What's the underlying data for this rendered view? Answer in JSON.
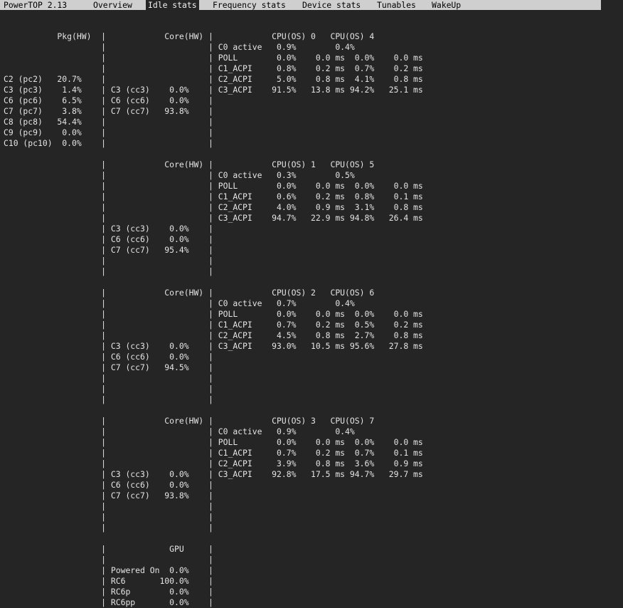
{
  "menu": {
    "app_title": "PowerTOP 2.13",
    "tabs": [
      {
        "label": "Overview",
        "active": false
      },
      {
        "label": "Idle stats",
        "active": true
      },
      {
        "label": "Frequency stats",
        "active": false
      },
      {
        "label": "Device stats",
        "active": false
      },
      {
        "label": "Tunables",
        "active": false
      },
      {
        "label": "WakeUp",
        "active": false
      }
    ]
  },
  "colors": {
    "background": "#252525",
    "menubar": "#cfcfcf",
    "text": "#e4e4e4"
  },
  "screen_lines": [
    "           Pkg(HW)  |            Core(HW) |            CPU(OS) 0   CPU(OS) 4",
    "                    |                     | C0 active   0.9%        0.4%",
    "                    |                     | POLL        0.0%    0.0 ms  0.0%    0.0 ms",
    "                    |                     | C1_ACPI     0.8%    0.2 ms  0.7%    0.2 ms",
    "C2 (pc2)   20.7%    |                     | C2_ACPI     5.0%    0.8 ms  4.1%    0.8 ms",
    "C3 (pc3)    1.4%    | C3 (cc3)    0.0%    | C3_ACPI    91.5%   13.8 ms 94.2%   25.1 ms",
    "C6 (pc6)    6.5%    | C6 (cc6)    0.0%    |",
    "C7 (pc7)    3.8%    | C7 (cc7)   93.8%    |",
    "C8 (pc8)   54.4%    |                     |",
    "C9 (pc9)    0.0%    |                     |",
    "C10 (pc10)  0.0%    |                     |",
    "",
    "                    |            Core(HW) |            CPU(OS) 1   CPU(OS) 5",
    "                    |                     | C0 active   0.3%        0.5%",
    "                    |                     | POLL        0.0%    0.0 ms  0.0%    0.0 ms",
    "                    |                     | C1_ACPI     0.6%    0.2 ms  0.8%    0.1 ms",
    "                    |                     | C2_ACPI     4.0%    0.9 ms  3.1%    0.8 ms",
    "                    |                     | C3_ACPI    94.7%   22.9 ms 94.8%   26.4 ms",
    "                    | C3 (cc3)    0.0%    |",
    "                    | C6 (cc6)    0.0%    |",
    "                    | C7 (cc7)   95.4%    |",
    "                    |                     |",
    "                    |                     |",
    "",
    "                    |            Core(HW) |            CPU(OS) 2   CPU(OS) 6",
    "                    |                     | C0 active   0.7%        0.4%",
    "                    |                     | POLL        0.0%    0.0 ms  0.0%    0.0 ms",
    "                    |                     | C1_ACPI     0.7%    0.2 ms  0.5%    0.2 ms",
    "                    |                     | C2_ACPI     4.5%    0.8 ms  2.7%    0.8 ms",
    "                    | C3 (cc3)    0.0%    | C3_ACPI    93.0%   10.5 ms 95.6%   27.8 ms",
    "                    | C6 (cc6)    0.0%    |",
    "                    | C7 (cc7)   94.5%    |",
    "                    |                     |",
    "                    |                     |",
    "                    |                     |",
    "",
    "                    |            Core(HW) |            CPU(OS) 3   CPU(OS) 7",
    "                    |                     | C0 active   0.9%        0.4%",
    "                    |                     | POLL        0.0%    0.0 ms  0.0%    0.0 ms",
    "                    |                     | C1_ACPI     0.7%    0.2 ms  0.7%    0.1 ms",
    "                    |                     | C2_ACPI     3.9%    0.8 ms  3.6%    0.9 ms",
    "                    | C3 (cc3)    0.0%    | C3_ACPI    92.8%   17.5 ms 94.7%   29.7 ms",
    "                    | C6 (cc6)    0.0%    |",
    "                    | C7 (cc7)   93.8%    |",
    "                    |                     |",
    "                    |                     |",
    "                    |                     |",
    "",
    "                    |             GPU     |",
    "                    |                     |",
    "                    | Powered On  0.0%    |",
    "                    | RC6       100.0%    |",
    "                    | RC6p        0.0%    |",
    "                    | RC6pp       0.0%    |"
  ]
}
